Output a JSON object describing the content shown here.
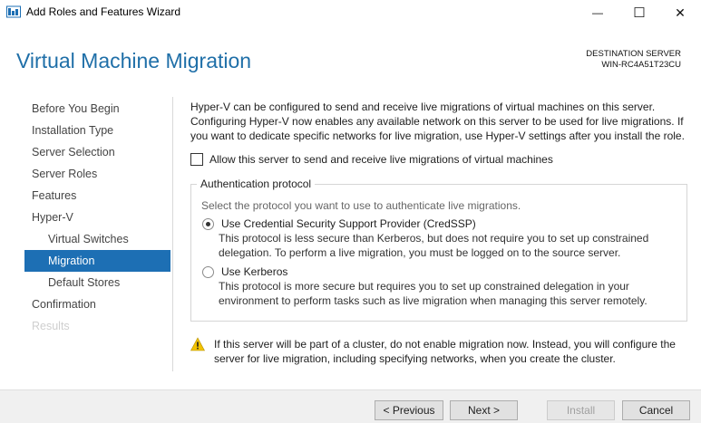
{
  "window": {
    "title": "Add Roles and Features Wizard",
    "minimize_glyph": "—",
    "maximize_glyph": "☐",
    "close_glyph": "✕"
  },
  "header": {
    "page_title": "Virtual Machine Migration",
    "destination_label": "DESTINATION SERVER",
    "destination_server": "WIN-RC4A51T23CU"
  },
  "nav": {
    "items": [
      {
        "label": "Before You Begin",
        "state": "normal"
      },
      {
        "label": "Installation Type",
        "state": "normal"
      },
      {
        "label": "Server Selection",
        "state": "normal"
      },
      {
        "label": "Server Roles",
        "state": "normal"
      },
      {
        "label": "Features",
        "state": "normal"
      },
      {
        "label": "Hyper-V",
        "state": "normal"
      },
      {
        "label": "Virtual Switches",
        "state": "sub"
      },
      {
        "label": "Migration",
        "state": "selected"
      },
      {
        "label": "Default Stores",
        "state": "sub"
      },
      {
        "label": "Confirmation",
        "state": "normal"
      },
      {
        "label": "Results",
        "state": "disabled"
      }
    ]
  },
  "content": {
    "intro_line1": "Hyper-V can be configured to send and receive live migrations of virtual machines on this server.",
    "intro_line2": "Configuring Hyper-V now enables any available network on this server to be used for live migrations. If",
    "intro_line3": "you want to dedicate specific networks for live migration, use Hyper-V settings after you install the role.",
    "allow_checkbox_label": "Allow this server to send and receive live migrations of virtual machines",
    "allow_checkbox_checked": false,
    "auth_group_title": "Authentication protocol",
    "auth_group_desc": "Select the protocol you want to use to authenticate live migrations.",
    "credssp_label": "Use Credential Security Support Provider (CredSSP)",
    "credssp_selected": true,
    "credssp_desc1": "This protocol is less secure than Kerberos, but does not require you to set up constrained",
    "credssp_desc2": "delegation. To perform a live migration, you must be logged on to the source server.",
    "kerberos_label": "Use Kerberos",
    "kerberos_selected": false,
    "kerberos_desc1": "This protocol is more secure but requires you to set up constrained delegation in your",
    "kerberos_desc2": "environment to perform tasks such as live migration when managing this server remotely.",
    "warning_line1": "If this server will be part of a cluster, do not enable migration now. Instead, you will configure the",
    "warning_line2": "server for live migration, including specifying networks, when you create the cluster."
  },
  "footer": {
    "previous_label": "< Previous",
    "next_label": "Next >",
    "install_label": "Install",
    "install_enabled": false,
    "cancel_label": "Cancel"
  },
  "colors": {
    "accent": "#1d6fb4",
    "title": "#1f6fa8",
    "warning": "#f2c200"
  }
}
